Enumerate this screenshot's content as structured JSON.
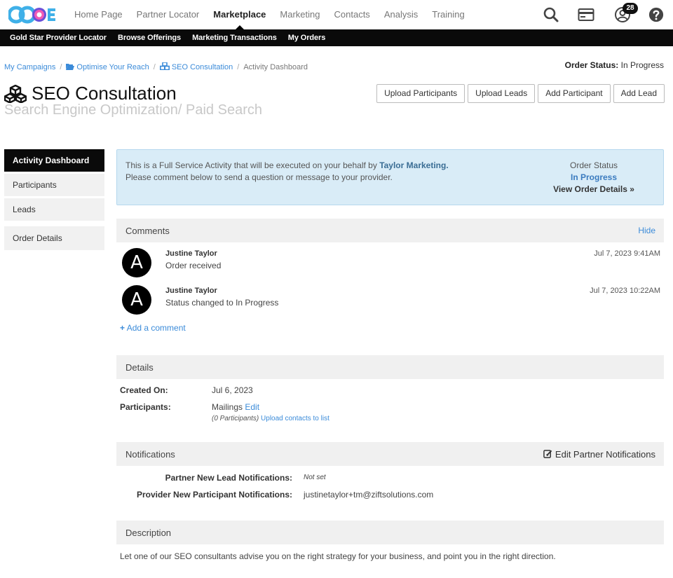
{
  "topnav": {
    "items": [
      {
        "label": "Home Page",
        "active": false
      },
      {
        "label": "Partner Locator",
        "active": false
      },
      {
        "label": "Marketplace",
        "active": true
      },
      {
        "label": "Marketing",
        "active": false
      },
      {
        "label": "Contacts",
        "active": false
      },
      {
        "label": "Analysis",
        "active": false
      },
      {
        "label": "Training",
        "active": false
      }
    ],
    "icons": [
      "search-icon",
      "payment-card-icon",
      "user-account-icon",
      "help-icon"
    ],
    "notification_count": "28"
  },
  "subnav": {
    "items": [
      "Gold Star Provider Locator",
      "Browse Offerings",
      "Marketing Transactions",
      "My Orders"
    ]
  },
  "breadcrumb": {
    "items": [
      "My Campaigns",
      "Optimise Your Reach",
      "SEO Consultation",
      "Activity Dashboard"
    ]
  },
  "order_status_top": {
    "label": "Order Status:",
    "value": "In Progress"
  },
  "page": {
    "title": "SEO Consultation",
    "subtitle": "Search Engine Optimization/ Paid Search"
  },
  "actions": [
    "Upload Participants",
    "Upload Leads",
    "Add Participant",
    "Add Lead"
  ],
  "sidemenu": {
    "items": [
      "Activity Dashboard",
      "Participants",
      "Leads",
      "Order Details"
    ]
  },
  "info": {
    "line1_prefix": "This is a Full Service Activity that will be executed on your behalf by",
    "provider": "Taylor Marketing.",
    "line2": "Please comment below to send a question or message to your provider.",
    "status_label": "Order Status",
    "status_value": "In Progress",
    "details_link": "View Order Details"
  },
  "comments": {
    "title": "Comments",
    "toggle": "Hide",
    "items": [
      {
        "initial": "A",
        "author": "Justine Taylor",
        "message": "Order received",
        "date": "Jul 7, 2023 9:41AM"
      },
      {
        "initial": "A",
        "author": "Justine Taylor",
        "message": "Status changed to In Progress",
        "date": "Jul 7, 2023 10:22AM"
      }
    ],
    "add_label": "Add a comment"
  },
  "details": {
    "title": "Details",
    "created_label": "Created On:",
    "created_value": "Jul 6, 2023",
    "participants_label": "Participants:",
    "participants_value": "Mailings",
    "edit_label": "Edit",
    "participants_count": "(0 Participants)",
    "upload_link": "Upload contacts to list"
  },
  "notifications": {
    "title": "Notifications",
    "edit_label": "Edit Partner Notifications",
    "partner_lead_label": "Partner New Lead Notifications:",
    "partner_lead_value": "Not set",
    "provider_participant_label": "Provider New Participant Notifications:",
    "provider_participant_value": "justinetaylor+tm@ziftsolutions.com"
  },
  "description": {
    "title": "Description",
    "text": "Let one of our SEO consultants advise you on the right strategy for your business, and point you in the right direction."
  },
  "colors": {
    "accent": "#3b8bd9",
    "nav_dark": "#0a0a0a",
    "info_bg": "#d9ecf7",
    "section_bg": "#f0f0f0"
  }
}
